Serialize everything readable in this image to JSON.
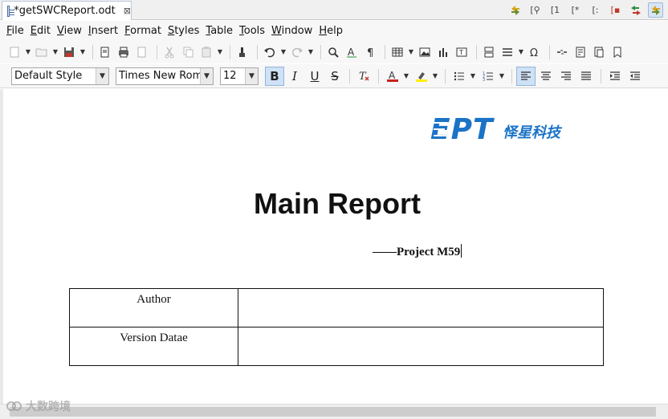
{
  "tab": {
    "title": "*getSWCReport.odt",
    "close": "⊠"
  },
  "menu": [
    "File",
    "Edit",
    "View",
    "Insert",
    "Format",
    "Styles",
    "Table",
    "Tools",
    "Window",
    "Help"
  ],
  "formatting": {
    "paragraph_style": "Default Style",
    "font_name": "Times New Roma",
    "font_size": "12"
  },
  "document": {
    "logo_text": "EPT",
    "logo_cn": "怿星科技",
    "title": "Main Report",
    "subtitle": "——Project M59",
    "table": [
      {
        "label": "Author",
        "value": ""
      },
      {
        "label": "Version Datae",
        "value": ""
      }
    ]
  },
  "watermark": "大数跨境",
  "colors": {
    "logo_blue": "#1a73c7",
    "active_button": "#cfe1f5"
  }
}
